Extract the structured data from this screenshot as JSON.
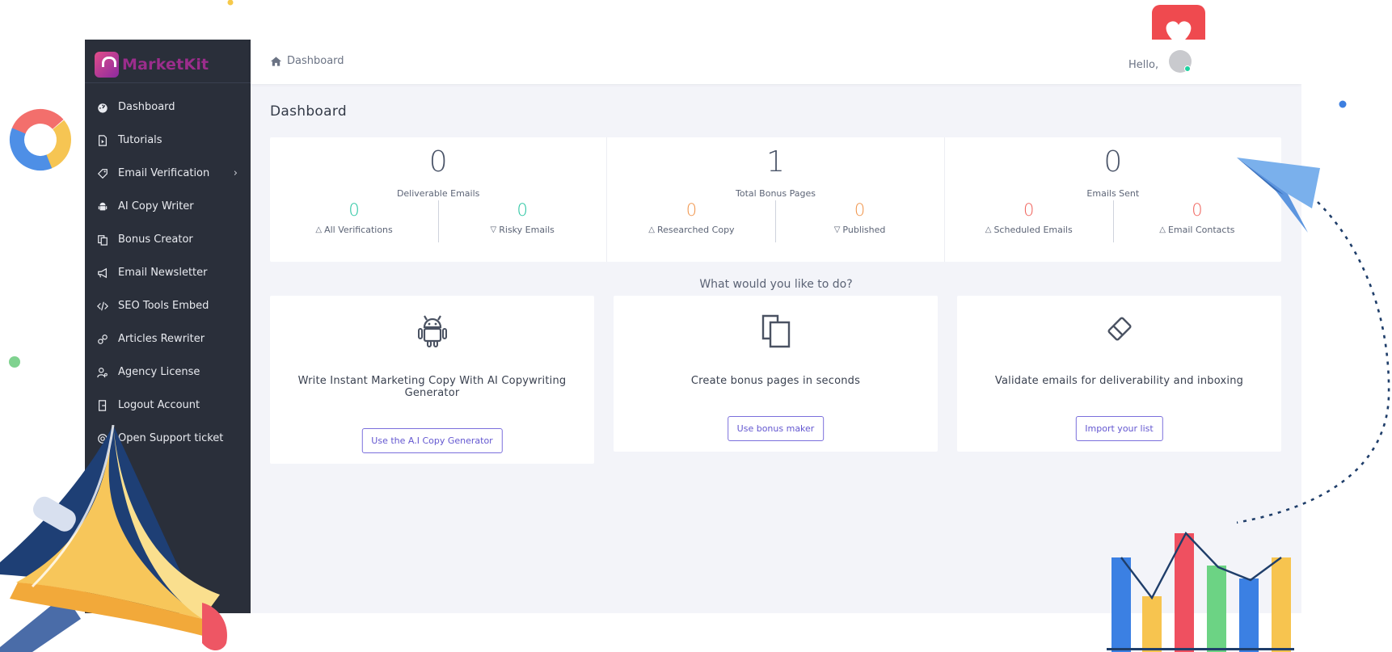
{
  "brand": {
    "name": "MarketKit"
  },
  "sidebar": {
    "items": [
      {
        "label": "Dashboard",
        "icon": "dashboard-gauge-icon"
      },
      {
        "label": "Tutorials",
        "icon": "video-file-icon"
      },
      {
        "label": "Email Verification",
        "icon": "tag-icon",
        "has_submenu": true
      },
      {
        "label": "AI Copy Writer",
        "icon": "android-icon"
      },
      {
        "label": "Bonus Creator",
        "icon": "copy-icon"
      },
      {
        "label": "Email Newsletter",
        "icon": "megaphone-icon"
      },
      {
        "label": "SEO Tools Embed",
        "icon": "code-icon"
      },
      {
        "label": "Articles Rewriter",
        "icon": "link-icon"
      },
      {
        "label": "Agency License",
        "icon": "user-key-icon"
      },
      {
        "label": "Logout Account",
        "icon": "logout-icon"
      },
      {
        "label": "Open Support ticket",
        "icon": "support-ticket-icon"
      }
    ]
  },
  "topbar": {
    "breadcrumb": "Dashboard",
    "greeting": "Hello,"
  },
  "page": {
    "title": "Dashboard"
  },
  "stats": [
    {
      "value": "0",
      "label": "Deliverable Emails",
      "left": {
        "value": "0",
        "label": "All Verifications",
        "color": "#25c4a0"
      },
      "right": {
        "value": "0",
        "label": "Risky Emails",
        "color": "#25c4a0"
      }
    },
    {
      "value": "1",
      "label": "Total Bonus Pages",
      "left": {
        "value": "0",
        "label": "Researched Copy",
        "color": "#f0944a"
      },
      "right": {
        "value": "0",
        "label": "Published",
        "color": "#f0944a"
      }
    },
    {
      "value": "0",
      "label": "Emails Sent",
      "left": {
        "value": "0",
        "label": "Scheduled Emails",
        "color": "#f0635c"
      },
      "right": {
        "value": "0",
        "label": "Email Contacts",
        "color": "#f0635c"
      }
    }
  ],
  "question": "What would you like to do?",
  "cards": [
    {
      "icon": "android-icon",
      "text": "Write Instant Marketing Copy With AI Copywriting Generator",
      "button": "Use the A.I Copy Generator"
    },
    {
      "icon": "copy-pages-icon",
      "text": "Create bonus pages in seconds",
      "button": "Use bonus maker"
    },
    {
      "icon": "eraser-icon",
      "text": "Validate emails for deliverability and inboxing",
      "button": "Import your list"
    }
  ],
  "colors": {
    "sidebar_bg": "#2a2f3a",
    "accent_button": "#6357d0",
    "green": "#25c4a0",
    "orange": "#f0944a",
    "red": "#f0635c"
  }
}
